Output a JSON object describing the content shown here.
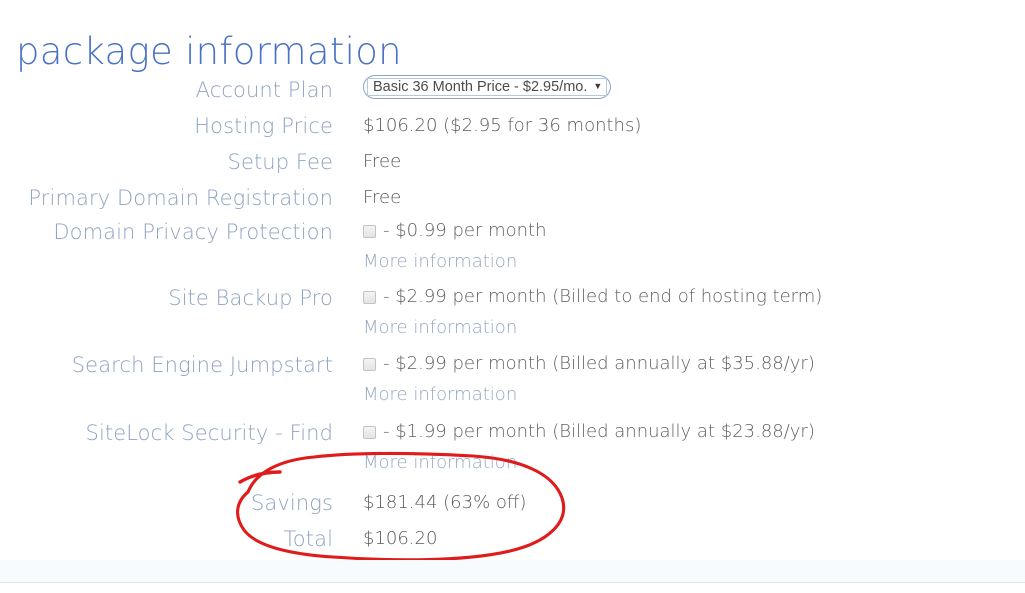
{
  "page": {
    "title": "package information"
  },
  "account_plan": {
    "label": "Account Plan",
    "selected_option": "Basic 36 Month Price - $2.95/mo.",
    "caret_icon": "chevron-down-icon"
  },
  "rows": {
    "hosting_price": {
      "label": "Hosting Price",
      "value": "$106.20  ($2.95 for 36 months)"
    },
    "setup_fee": {
      "label": "Setup Fee",
      "value": "Free"
    },
    "primary_domain": {
      "label": "Primary Domain Registration",
      "value": "Free"
    },
    "domain_privacy": {
      "label": "Domain Privacy Protection",
      "option": "- $0.99 per month",
      "more": "More information",
      "checked": false
    },
    "site_backup": {
      "label": "Site Backup Pro",
      "option": "- $2.99 per month (Billed to end of hosting term)",
      "more": "More information",
      "checked": false
    },
    "search_engine": {
      "label": "Search Engine Jumpstart",
      "option": "- $2.99 per month (Billed annually at $35.88/yr)",
      "more": "More information",
      "checked": false
    },
    "sitelock": {
      "label": "SiteLock Security - Find",
      "option": "- $1.99 per month (Billed annually at $23.88/yr)",
      "more": "More information",
      "checked": false
    },
    "savings": {
      "label": "Savings",
      "value": "$181.44 (63% off)"
    },
    "total": {
      "label": "Total",
      "value": "$106.20"
    }
  },
  "annotation": {
    "shape": "hand-drawn-red-ellipse",
    "color": "#e01b1b"
  },
  "colors": {
    "title": "#4a72c4",
    "label": "#8fa3c0",
    "value": "#5a5a5a",
    "link": "#94a7c2",
    "annotation": "#e01b1b",
    "divider": "#dfe7ee"
  }
}
